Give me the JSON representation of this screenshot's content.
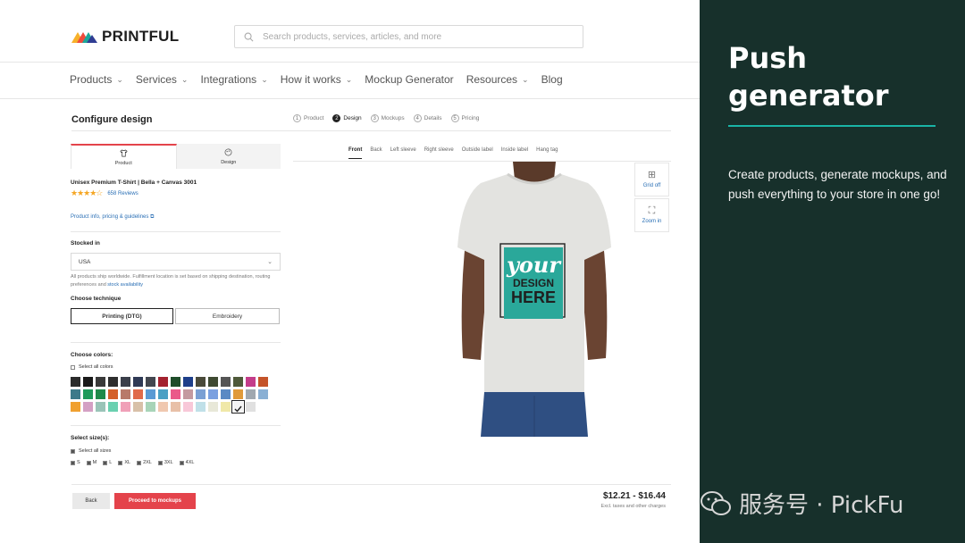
{
  "brand": {
    "name": "PRINTFUL"
  },
  "search": {
    "placeholder": "Search products, services, articles, and more"
  },
  "nav": [
    {
      "label": "Products",
      "dropdown": true
    },
    {
      "label": "Services",
      "dropdown": true
    },
    {
      "label": "Integrations",
      "dropdown": true
    },
    {
      "label": "How it works",
      "dropdown": true
    },
    {
      "label": "Mockup Generator",
      "dropdown": false
    },
    {
      "label": "Resources",
      "dropdown": true
    },
    {
      "label": "Blog",
      "dropdown": false
    }
  ],
  "configure": {
    "title": "Configure design",
    "steps": [
      {
        "num": "1",
        "label": "Product",
        "active": false
      },
      {
        "num": "2",
        "label": "Design",
        "active": true
      },
      {
        "num": "3",
        "label": "Mockups",
        "active": false
      },
      {
        "num": "4",
        "label": "Details",
        "active": false
      },
      {
        "num": "5",
        "label": "Pricing",
        "active": false
      }
    ]
  },
  "panel": {
    "tabs": [
      {
        "label": "Product",
        "icon": "tshirt-icon"
      },
      {
        "label": "Design",
        "icon": "palette-icon"
      }
    ],
    "product_name": "Unisex Premium T-Shirt | Bella + Canvas 3001",
    "stars": "★★★★☆",
    "reviews": "658 Reviews",
    "product_link": "Product info, pricing & guidelines",
    "stocked_label": "Stocked in",
    "stocked_value": "USA",
    "note_text": "All products ship worldwide. Fulfillment location is set based on shipping destination, routing preferences and ",
    "note_link": "stock availability",
    "technique_label": "Choose technique",
    "techniques": [
      "Printing (DTG)",
      "Embroidery"
    ],
    "colors_label": "Choose colors:",
    "select_all_colors": "Select all colors",
    "colors": [
      "#2b2b2b",
      "#1a1a1a",
      "#3a3a3a",
      "#2e2e2e",
      "#3a3f4a",
      "#2f3a55",
      "#43474f",
      "#a3222f",
      "#1f4d2b",
      "#1e3f8a",
      "#4a4a3a",
      "#3f4a32",
      "#555555",
      "#4f5a3a",
      "#c43d8a",
      "#c4542a",
      "#3d7a8a",
      "#1f9a5a",
      "#1f8a4a",
      "#d4602a",
      "#b87a6a",
      "#e06a4a",
      "#5a9ad4",
      "#4aa0c4",
      "#ea5a8a",
      "#c49aa0",
      "#7aa0d4",
      "#7aa0e0",
      "#5a8ac4",
      "#e09a3a",
      "#a0a8b0",
      "#8ab0d4",
      "#f0a030",
      "#d4a0c4",
      "#9ac4b8",
      "#6ad0b0",
      "#f0a0b8",
      "#d8c0a8",
      "#a8d4b8",
      "#f0c8b0",
      "#e8c0a8",
      "#f8c8d8",
      "#c0e0e8",
      "#e8e8d8",
      "#f0e8a8",
      "#f4f4f4",
      "#e0e0e0"
    ],
    "selected_color_index": 45,
    "size_label": "Select size(s):",
    "select_all_sizes": "Select all sizes",
    "sizes": [
      "S",
      "M",
      "L",
      "XL",
      "2XL",
      "3XL",
      "4XL"
    ]
  },
  "preview": {
    "tabs": [
      "Front",
      "Back",
      "Left sleeve",
      "Right sleeve",
      "Outside label",
      "Inside label",
      "Hang tag"
    ],
    "active_tab": "Front",
    "grid_label": "Grid off",
    "zoom_label": "Zoom in",
    "design_text": [
      "your",
      "DESIGN",
      "HERE"
    ],
    "design_color": "#2aa89a"
  },
  "footer": {
    "back": "Back",
    "proceed": "Proceed to mockups",
    "price": "$12.21 - $16.44",
    "price_note": "Excl. taxes and other charges"
  },
  "side": {
    "title_line1": "Push",
    "title_line2": "generator",
    "description": "Create products, generate mockups, and push everything to your store in one go!",
    "watermark": "服务号 · PickFu",
    "accent": "#19b4a6",
    "background": "#17302b"
  }
}
